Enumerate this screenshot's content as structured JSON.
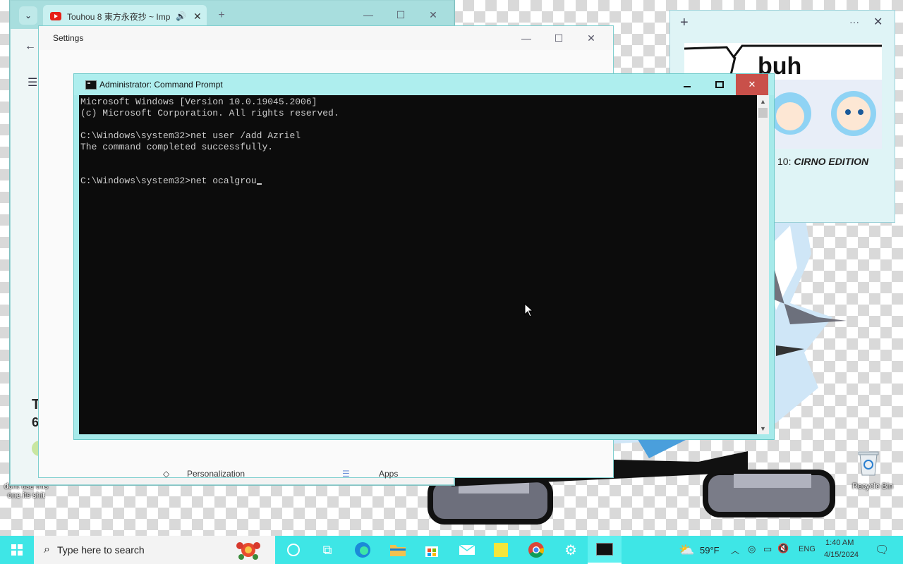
{
  "desktop": {
    "icon_left_label": "dont use this one its shit",
    "recycle_bin_label": "Recycle Bin"
  },
  "browser": {
    "tab_title": "Touhou 8 東方永夜抄 ~ Imp",
    "minimize": "—",
    "maximize": "☐",
    "close": "✕",
    "back": "←",
    "menu": "☰",
    "sidebar_text_1": "Personalization",
    "sidebar_text_2": "Apps",
    "partial_heading": "T",
    "partial_number": "6"
  },
  "settings": {
    "title": "Settings",
    "minimize": "—",
    "maximize": "☐",
    "close": "✕",
    "item_personalization": "Personalization",
    "item_apps": "Apps"
  },
  "cmd": {
    "title": "Administrator: Command Prompt",
    "lines": [
      "Microsoft Windows [Version 10.0.19045.2006]",
      "(c) Microsoft Corporation. All rights reserved.",
      "",
      "C:\\Windows\\system32>net user /add Azriel",
      "The command completed successfully.",
      "",
      "",
      "C:\\Windows\\system32>net ocalgrou"
    ]
  },
  "widget": {
    "add": "+",
    "more": "···",
    "close": "✕",
    "image_text": "buh",
    "caption_prefix": "10:",
    "caption_bold": "CIRNO EDITION"
  },
  "taskbar": {
    "search_placeholder": "Type here to search",
    "weather": "59°F",
    "language": "ENG",
    "time": "1:40 AM",
    "date": "4/15/2024"
  },
  "colors": {
    "taskbar": "#3ee6e6",
    "cmd_frame": "#a6eaea",
    "cmd_close": "#c9504a"
  }
}
